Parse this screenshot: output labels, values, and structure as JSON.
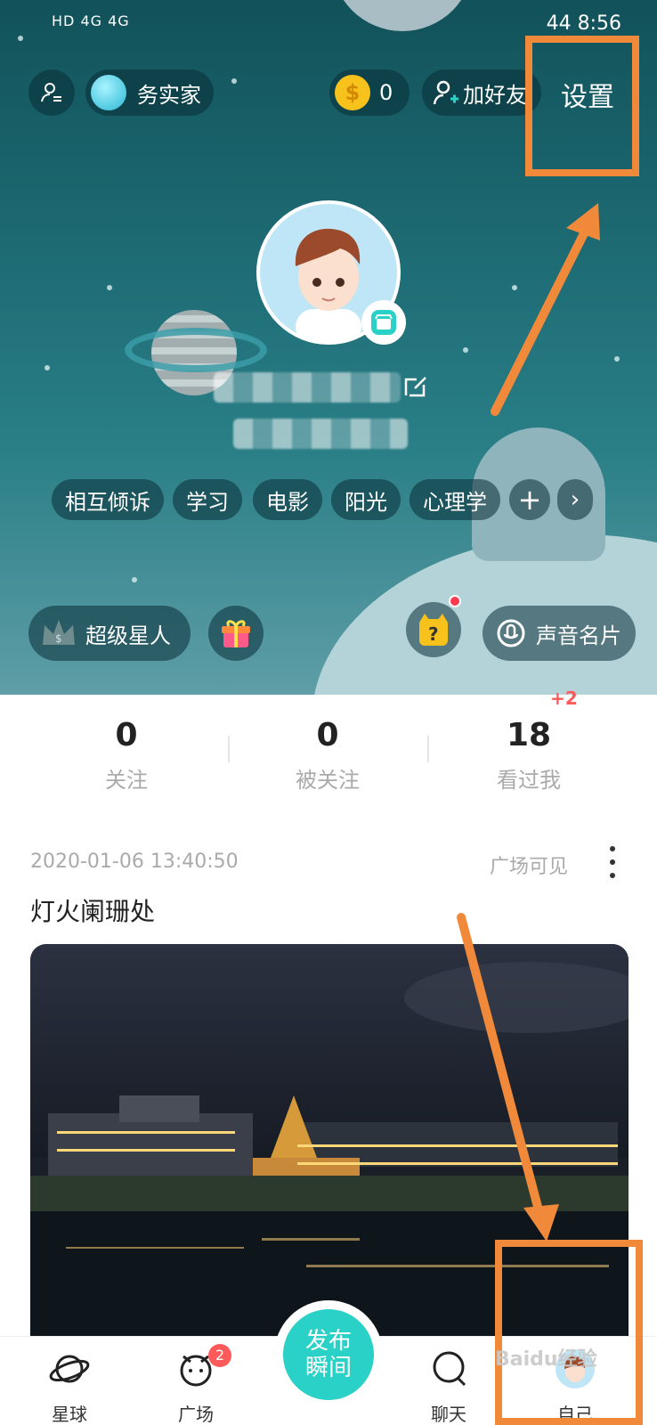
{
  "status_bar": {
    "left": "HD 4G 4G",
    "right": "44  8:56"
  },
  "top_bar": {
    "vip_name": "务实家",
    "coins": "0",
    "add_friend": "加好友",
    "settings": "设置"
  },
  "profile": {
    "tags": [
      "相互倾诉",
      "学习",
      "电影",
      "阳光",
      "心理学"
    ]
  },
  "actions": {
    "super_star": "超级星人",
    "voice_card": "声音名片"
  },
  "stats": [
    {
      "value": "0",
      "label": "关注"
    },
    {
      "value": "0",
      "label": "被关注"
    },
    {
      "value": "18",
      "label": "看过我",
      "badge": "+2"
    }
  ],
  "post": {
    "time": "2020-01-06 13:40:50",
    "visibility": "广场可见",
    "title": "灯火阑珊处"
  },
  "bottom_nav": {
    "items": [
      {
        "label": "星球"
      },
      {
        "label": "广场",
        "badge": "2"
      },
      {
        "label": "聊天"
      },
      {
        "label": "自己"
      }
    ],
    "publish": "发布\n瞬间"
  },
  "watermark": "Baidu经验",
  "colors": {
    "accent": "#2ad1c6",
    "annotation": "#f08a3a",
    "badge": "#ff5a5a"
  }
}
